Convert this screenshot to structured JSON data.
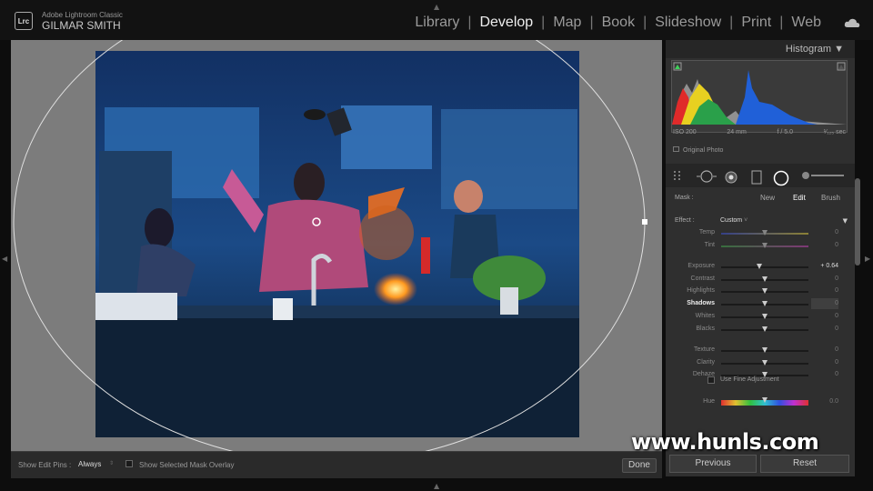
{
  "app": {
    "logo_text": "Lrc",
    "app_name": "Adobe Lightroom Classic",
    "user_name": "GILMAR SMITH"
  },
  "modules": [
    {
      "label": "Library",
      "active": false
    },
    {
      "label": "Develop",
      "active": true
    },
    {
      "label": "Map",
      "active": false
    },
    {
      "label": "Book",
      "active": false
    },
    {
      "label": "Slideshow",
      "active": false
    },
    {
      "label": "Print",
      "active": false
    },
    {
      "label": "Web",
      "active": false
    }
  ],
  "toolbar": {
    "show_edit_pins_label": "Show Edit Pins :",
    "show_edit_pins_value": "Always",
    "show_overlay_label": "Show Selected Mask Overlay",
    "done_label": "Done"
  },
  "histogram": {
    "title": "Histogram",
    "iso": "ISO 200",
    "focal": "24 mm",
    "aperture": "f / 5.0",
    "shutter": "¹⁄₁₂₅ sec",
    "original_photo_label": "Original Photo"
  },
  "mask": {
    "label": "Mask :",
    "new_label": "New",
    "edit_label": "Edit",
    "brush_label": "Brush"
  },
  "effect": {
    "label": "Effect :",
    "value": "Custom"
  },
  "sliders": [
    {
      "label": "Temp",
      "value": "0",
      "pos": 0.5
    },
    {
      "label": "Tint",
      "value": "0",
      "pos": 0.5
    },
    {
      "label": "Exposure",
      "value": "+ 0.64",
      "pos": 0.44
    },
    {
      "label": "Contrast",
      "value": "0",
      "pos": 0.5
    },
    {
      "label": "Highlights",
      "value": "0",
      "pos": 0.5
    },
    {
      "label": "Shadows",
      "value": "0",
      "pos": 0.5
    },
    {
      "label": "Whites",
      "value": "0",
      "pos": 0.5
    },
    {
      "label": "Blacks",
      "value": "0",
      "pos": 0.5
    },
    {
      "label": "Texture",
      "value": "0",
      "pos": 0.5
    },
    {
      "label": "Clarity",
      "value": "0",
      "pos": 0.5
    },
    {
      "label": "Dehaze",
      "value": "0",
      "pos": 0.5
    },
    {
      "label": "Hue",
      "value": "0.0",
      "pos": 0.5
    }
  ],
  "fine_adjustment_label": "Use Fine Adjustment",
  "buttons": {
    "previous": "Previous",
    "reset": "Reset"
  },
  "watermark": "www.hunls.com"
}
